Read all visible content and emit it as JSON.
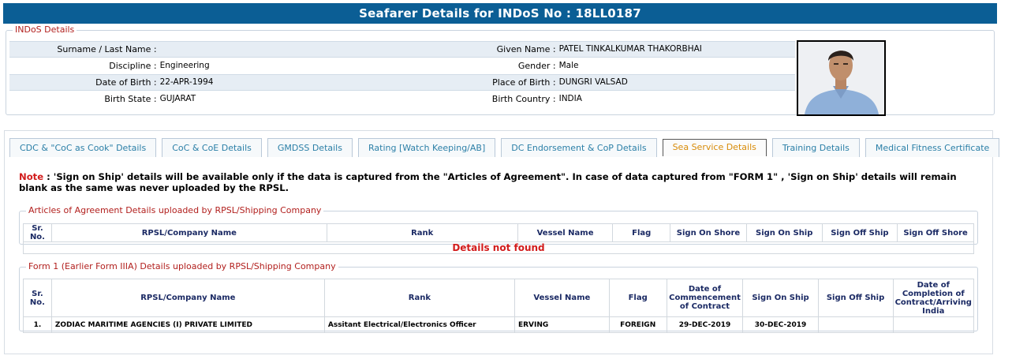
{
  "title": "Seafarer Details for INDoS No : 18LL0187",
  "indos": {
    "legend": "INDoS Details",
    "rows": [
      {
        "l1": "Surname / Last Name :",
        "v1": "",
        "l2": "Given Name :",
        "v2": "PATEL TINKALKUMAR THAKORBHAI"
      },
      {
        "l1": "Discipline :",
        "v1": "Engineering",
        "l2": "Gender :",
        "v2": "Male"
      },
      {
        "l1": "Date of Birth :",
        "v1": "22-APR-1994",
        "l2": "Place of Birth :",
        "v2": "DUNGRI VALSAD"
      },
      {
        "l1": "Birth State :",
        "v1": "GUJARAT",
        "l2": "Birth Country :",
        "v2": "INDIA"
      }
    ]
  },
  "tabs": [
    {
      "label": "CDC & \"CoC as Cook\" Details",
      "active": false
    },
    {
      "label": "CoC & CoE Details",
      "active": false
    },
    {
      "label": "GMDSS Details",
      "active": false
    },
    {
      "label": "Rating [Watch Keeping/AB]",
      "active": false
    },
    {
      "label": "DC Endorsement & CoP Details",
      "active": false
    },
    {
      "label": "Sea Service Details",
      "active": true
    },
    {
      "label": "Training Details",
      "active": false
    },
    {
      "label": "Medical Fitness Certificate",
      "active": false
    }
  ],
  "note": {
    "keyword": "Note",
    "text": " : 'Sign on Ship' details will be available only if the data is captured from the \"Articles of Agreement\". In case of data captured from \"FORM 1\" , 'Sign on Ship' details will remain blank as the same was never uploaded by the RPSL."
  },
  "articles": {
    "legend": "Articles of Agreement Details uploaded by RPSL/Shipping Company",
    "headers": [
      "Sr. No.",
      "RPSL/Company Name",
      "Rank",
      "Vessel Name",
      "Flag",
      "Sign On Shore",
      "Sign On Ship",
      "Sign Off Ship",
      "Sign Off Shore"
    ],
    "empty_message": "Details not found"
  },
  "form1": {
    "legend": "Form 1 (Earlier Form IIIA) Details uploaded by RPSL/Shipping Company",
    "headers": [
      "Sr. No.",
      "RPSL/Company Name",
      "Rank",
      "Vessel Name",
      "Flag",
      "Date of Commencement of Contract",
      "Sign On Ship",
      "Sign Off Ship",
      "Date of Completion of Contract/Arriving India"
    ],
    "rows": [
      {
        "sr": "1.",
        "company": "ZODIAC MARITIME AGENCIES (I) PRIVATE LIMITED",
        "rank": "Assitant Electrical/Electronics Officer",
        "vessel": "ERVING",
        "flag": "FOREIGN",
        "commence": "29-DEC-2019",
        "sign_on": "30-DEC-2019",
        "sign_off": "",
        "completion": ""
      }
    ]
  }
}
